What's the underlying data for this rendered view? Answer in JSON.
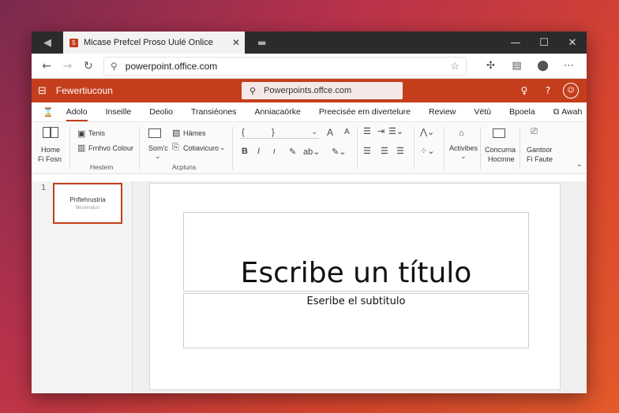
{
  "browser": {
    "tab_title": "Micase Prefcel   Proso Uulé Onlice",
    "tab_favicon": "5",
    "url": "powerpoint.office.com",
    "icons": [
      "back-arrow-icon",
      "forward-arrow-icon",
      "reload-icon",
      "search-icon",
      "star-icon",
      "extension-icon",
      "reader-icon",
      "shield-icon",
      "more-icon"
    ]
  },
  "app": {
    "name": "Fewertiucoun",
    "search_text": "Powerpoints.offce.com"
  },
  "ribbon_tabs": [
    "Adolo",
    "Inseille",
    "Deolio",
    "Transiéones",
    "Anniacaörke",
    "Preecisée em divertelure",
    "Review",
    "Vëtù",
    "Bpoela",
    "Awah"
  ],
  "ribbon": {
    "home_label_1": "Home",
    "home_label_2": "Fi Fosn",
    "tenis": "Tenis",
    "fruhvo_colour": "Frnhvo Colour",
    "group_hestem": "Hestem",
    "somc": "Som'c",
    "hames": "Hämes",
    "cotiavicuro": "Cotiavicuro",
    "group_acpluns": "Acpluns",
    "font_a_big": "A",
    "font_a_small": "A",
    "bold": "B",
    "italic": "I",
    "actives": "Activibes",
    "concuna_1": "Concurna",
    "concuna_2": "Hocmne",
    "gantoor_1": "Gantoor",
    "gantoor_2": "Fi Faute"
  },
  "slide": {
    "number": "1",
    "thumb_title": "Pnftehrustria",
    "thumb_sub": "Besionatus",
    "title": "Escribe un título",
    "subtitle": "Eseribe el subtitulo"
  },
  "colors": {
    "accent": "#c43e1c",
    "tabbar": "#2b2b2b"
  }
}
